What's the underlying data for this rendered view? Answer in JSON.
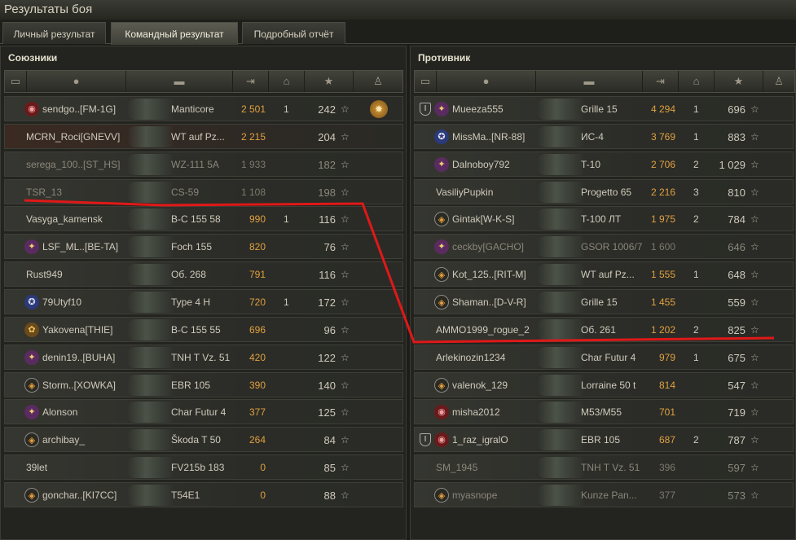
{
  "window": {
    "title": "Результаты боя"
  },
  "tabs": [
    {
      "label": "Личный результат"
    },
    {
      "label": "Командный результат"
    },
    {
      "label": "Подробный отчёт"
    }
  ],
  "allies": {
    "title": "Союзники",
    "header_icons": [
      "shield-icon",
      "player-icon",
      "tank-icon",
      "damage-icon",
      "frags-icon",
      "star-icon",
      "medal-icon"
    ],
    "rows": [
      {
        "player": "sendgo..[FM-1G]",
        "tank": "Manticore",
        "damage": "2 501",
        "frags": "1",
        "xp": "242",
        "clan_icon": "red",
        "medal": true
      },
      {
        "player": "MCRN_Roci[GNEVV]",
        "tank": "WT auf Pz...",
        "damage": "2 215",
        "frags": "",
        "xp": "204",
        "clan_icon": "",
        "alt": true
      },
      {
        "player": "serega_100..[ST_HS]",
        "tank": "WZ-111 5A",
        "damage": "1 933",
        "frags": "",
        "xp": "182",
        "clan_icon": "",
        "dead": true
      },
      {
        "player": "TSR_13",
        "tank": "CS-59",
        "damage": "1 108",
        "frags": "",
        "xp": "198",
        "clan_icon": "",
        "dead": true
      },
      {
        "player": "Vasyga_kamensk",
        "tank": "B-C 155 58",
        "damage": "990",
        "frags": "1",
        "xp": "116",
        "clan_icon": ""
      },
      {
        "player": "LSF_ML..[BE-TA]",
        "tank": "Foch 155",
        "damage": "820",
        "frags": "",
        "xp": "76",
        "clan_icon": "emb"
      },
      {
        "player": "Rust949",
        "tank": "Об. 268",
        "damage": "791",
        "frags": "",
        "xp": "116",
        "clan_icon": ""
      },
      {
        "player": "79Utyf10",
        "tank": "Type 4 H",
        "damage": "720",
        "frags": "1",
        "xp": "172",
        "clan_icon": "blue"
      },
      {
        "player": "Yakovena[THIE]",
        "tank": "B-C 155 55",
        "damage": "696",
        "frags": "",
        "xp": "96",
        "clan_icon": "gold"
      },
      {
        "player": "denin19..[BUHA]",
        "tank": "TNH T Vz. 51",
        "damage": "420",
        "frags": "",
        "xp": "122",
        "clan_icon": "emb"
      },
      {
        "player": "Storm..[XOWKA]",
        "tank": "EBR 105",
        "damage": "390",
        "frags": "",
        "xp": "140",
        "clan_icon": "orange"
      },
      {
        "player": "Alonson",
        "tank": "Char Futur 4",
        "damage": "377",
        "frags": "",
        "xp": "125",
        "clan_icon": "emb"
      },
      {
        "player": "archibay_",
        "tank": "Škoda T 50",
        "damage": "264",
        "frags": "",
        "xp": "84",
        "clan_icon": "orange"
      },
      {
        "player": "39let",
        "tank": "FV215b 183",
        "damage": "0",
        "frags": "",
        "xp": "85",
        "clan_icon": ""
      },
      {
        "player": "gonchar..[KI7CC]",
        "tank": "T54E1",
        "damage": "0",
        "frags": "",
        "xp": "88",
        "clan_icon": "orange"
      }
    ]
  },
  "enemies": {
    "title": "Противник",
    "header_icons": [
      "shield-icon",
      "player-icon",
      "tank-icon",
      "damage-icon",
      "frags-icon",
      "star-icon",
      "medal-icon"
    ],
    "rows": [
      {
        "player": "Mueeza555",
        "tank": "Grille 15",
        "damage": "4 294",
        "frags": "1",
        "xp": "696",
        "clan_icon": "emb",
        "shield": true
      },
      {
        "player": "MissMa..[NR-88]",
        "tank": "ИС-4",
        "damage": "3 769",
        "frags": "1",
        "xp": "883",
        "clan_icon": "blue"
      },
      {
        "player": "Dalnoboy792",
        "tank": "T-10",
        "damage": "2 706",
        "frags": "2",
        "xp": "1 029",
        "clan_icon": "emb"
      },
      {
        "player": "VasiliyPupkin",
        "tank": "Progetto 65",
        "damage": "2 216",
        "frags": "3",
        "xp": "810",
        "clan_icon": ""
      },
      {
        "player": "Gintak[W-K-S]",
        "tank": "T-100 ЛТ",
        "damage": "1 975",
        "frags": "2",
        "xp": "784",
        "clan_icon": "orange"
      },
      {
        "player": "ceckby[GACHO]",
        "tank": "GSOR 1006/7",
        "damage": "1 600",
        "frags": "",
        "xp": "646",
        "clan_icon": "emb",
        "dead": true
      },
      {
        "player": "Kot_125..[RIT-M]",
        "tank": "WT auf Pz...",
        "damage": "1 555",
        "frags": "1",
        "xp": "648",
        "clan_icon": "orange"
      },
      {
        "player": "Shaman..[D-V-R]",
        "tank": "Grille 15",
        "damage": "1 455",
        "frags": "",
        "xp": "559",
        "clan_icon": "orange"
      },
      {
        "player": "AMMO1999_rogue_2",
        "tank": "Об. 261",
        "damage": "1 202",
        "frags": "2",
        "xp": "825",
        "clan_icon": ""
      },
      {
        "player": "Arlekinozin1234",
        "tank": "Char Futur 4",
        "damage": "979",
        "frags": "1",
        "xp": "675",
        "clan_icon": ""
      },
      {
        "player": "valenok_129",
        "tank": "Lorraine 50 t",
        "damage": "814",
        "frags": "",
        "xp": "547",
        "clan_icon": "orange"
      },
      {
        "player": "misha2012",
        "tank": "M53/M55",
        "damage": "701",
        "frags": "",
        "xp": "719",
        "clan_icon": "red"
      },
      {
        "player": "1_raz_igralO",
        "tank": "EBR 105",
        "damage": "687",
        "frags": "2",
        "xp": "787",
        "clan_icon": "red",
        "shield": true
      },
      {
        "player": "SM_1945",
        "tank": "TNH T Vz. 51",
        "damage": "396",
        "frags": "",
        "xp": "597",
        "clan_icon": "",
        "dead": true
      },
      {
        "player": "myasnope",
        "tank": "Kunze Pan...",
        "damage": "377",
        "frags": "",
        "xp": "573",
        "clan_icon": "orange",
        "dead": true
      }
    ]
  },
  "colors": {
    "damage": "#e0a040",
    "annotation": "#e01818"
  }
}
